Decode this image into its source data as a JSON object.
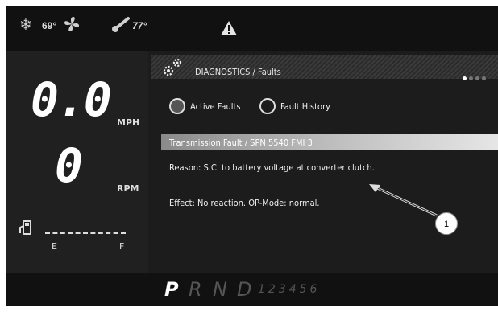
{
  "status_bar": {
    "snowflake_icon": "snowflake-icon",
    "ac_temp": "69°",
    "fan_icon": "fan-icon",
    "thermometer_icon": "thermometer-icon",
    "engine_temp": "77°",
    "warning_icon": "warning-triangle-icon"
  },
  "gauges": {
    "speed_value": "0.0",
    "speed_unit": "MPH",
    "rpm_value": "0",
    "rpm_unit": "RPM",
    "fuel_icon": "fuel-pump-icon",
    "fuel_empty_label": "E",
    "fuel_full_label": "F",
    "fuel_level": 0
  },
  "diagnostics": {
    "gear_icon": "gears-icon",
    "title": "DIAGNOSTICS / Faults",
    "page_dots": {
      "count": 4,
      "active_index": 0
    },
    "tabs": [
      {
        "label": "Active Faults",
        "selected": true
      },
      {
        "label": "Fault History",
        "selected": false
      }
    ],
    "fault": {
      "title": "Transmission Fault / SPN 5540 FMI 3",
      "reason": "Reason: S.C. to battery voltage at converter clutch.",
      "effect": "Effect: No reaction. OP-Mode: normal."
    },
    "callout_number": "1"
  },
  "gear_selector": {
    "letters": [
      "P",
      "R",
      "N",
      "D"
    ],
    "selected": "P",
    "numbers": "123456"
  },
  "colors": {
    "background": "#1b1b1b",
    "bars": "#111111",
    "text": "#eeeeee",
    "inactive_gear": "#555555"
  }
}
